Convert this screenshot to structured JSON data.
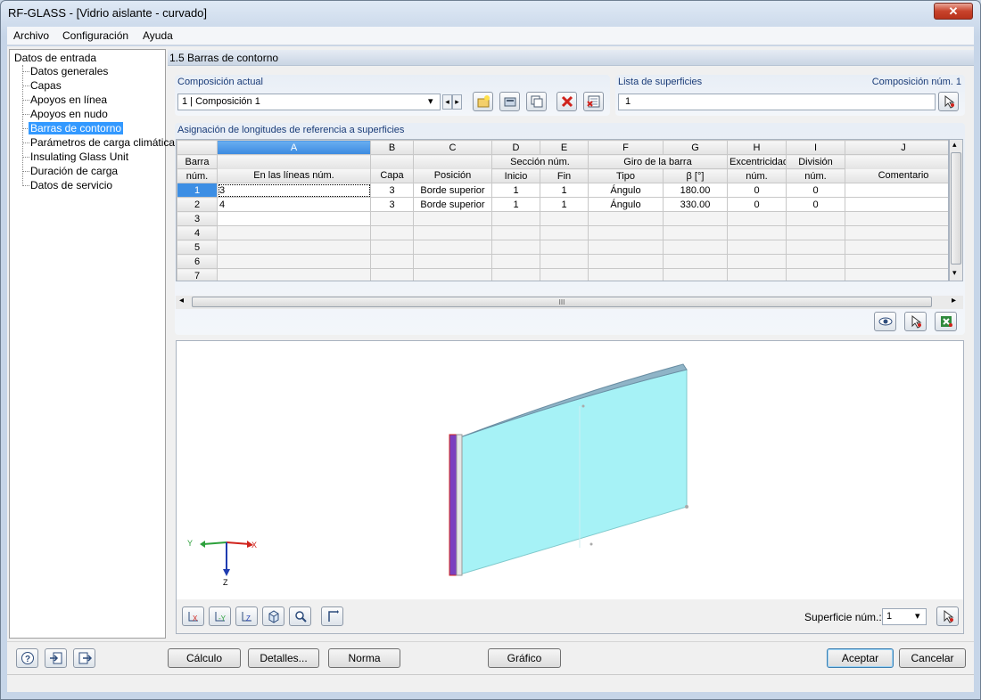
{
  "window": {
    "title": "RF-GLASS - [Vidrio aislante - curvado]",
    "close_glyph": "✕"
  },
  "menu": [
    "Archivo",
    "Configuración",
    "Ayuda"
  ],
  "nav": {
    "root": "Datos de entrada",
    "items": [
      "Datos generales",
      "Capas",
      "Apoyos en línea",
      "Apoyos en nudo",
      "Barras de contorno",
      "Parámetros de carga climática",
      "Insulating Glass Unit",
      "Duración de carga",
      "Datos de servicio"
    ],
    "selected_index": 4
  },
  "section": {
    "title": "1.5 Barras de contorno"
  },
  "composition": {
    "label": "Composición actual",
    "value": "1 | Composición 1"
  },
  "surfaces": {
    "label": "Lista de superficies",
    "num_label": "Composición núm. 1",
    "value": "1"
  },
  "table": {
    "caption": "Asignación de longitudes de referencia a superficies",
    "letters": [
      "A",
      "B",
      "C",
      "D",
      "E",
      "F",
      "G",
      "H",
      "I",
      "J"
    ],
    "rowhdr": [
      "Barra",
      "núm."
    ],
    "group_top": {
      "D": "Sección núm.",
      "F": "Giro de la barra",
      "H": "Excentricidad",
      "I": "División"
    },
    "sub": {
      "A": "En las líneas núm.",
      "B": "Capa",
      "C": "Posición",
      "D": "Inicio",
      "E": "Fin",
      "F": "Tipo",
      "G": "β [°]",
      "H": "núm.",
      "I": "núm.",
      "J": "Comentario"
    },
    "rows": [
      {
        "num": "1",
        "a": "3",
        "b": "3",
        "c": "Borde superior",
        "d": "1",
        "e": "1",
        "f": "Ángulo",
        "g": "180.00",
        "h": "0",
        "i": "0",
        "j": ""
      },
      {
        "num": "2",
        "a": "4",
        "b": "3",
        "c": "Borde superior",
        "d": "1",
        "e": "1",
        "f": "Ángulo",
        "g": "330.00",
        "h": "0",
        "i": "0",
        "j": ""
      },
      {
        "num": "3"
      },
      {
        "num": "4"
      },
      {
        "num": "5"
      },
      {
        "num": "6"
      },
      {
        "num": "7"
      }
    ],
    "hscroll_thumb": "III"
  },
  "view": {
    "axis_y": "Y",
    "axis_x": "X",
    "axis_z": "Z"
  },
  "surface_select": {
    "label": "Superficie núm.:",
    "value": "1"
  },
  "buttons": {
    "calculo": "Cálculo",
    "detalles": "Detalles...",
    "norma": "Norma",
    "grafico": "Gráfico",
    "aceptar": "Aceptar",
    "cancelar": "Cancelar"
  },
  "icons": {
    "help": "?",
    "arrow_down": "▾",
    "arrow_left": "◂",
    "arrow_right": "▸",
    "arrow_up": "▴"
  },
  "colors": {
    "accent": "#3399ff",
    "glass": "#a6f2f6",
    "edge": "#7a3fbf"
  }
}
